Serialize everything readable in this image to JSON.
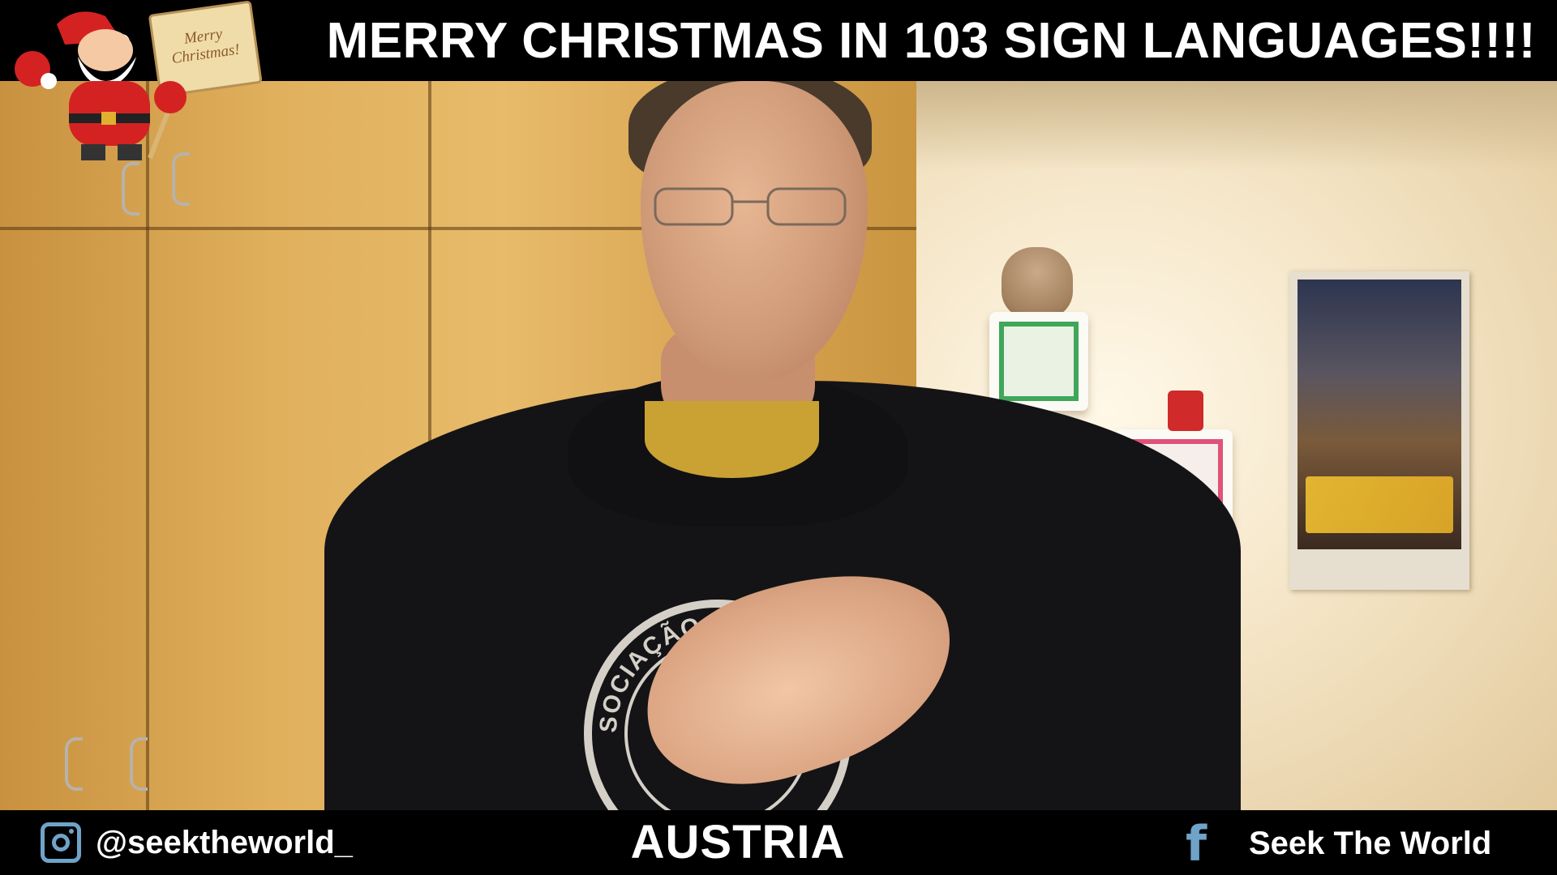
{
  "header": {
    "title": "MERRY CHRISTMAS IN 103 SIGN LANGUAGES!!!!"
  },
  "sticker": {
    "sign_line1": "Merry",
    "sign_line2": "Christmas!"
  },
  "hoodie": {
    "print_text": "SOCIAÇÃO CHAPECOENSE"
  },
  "footer": {
    "instagram_handle": "@seektheworld_",
    "country": "AUSTRIA",
    "facebook_page": "Seek The World"
  },
  "icons": {
    "instagram": "instagram-icon",
    "facebook": "facebook-icon",
    "santa": "santa-claus-icon"
  },
  "colors": {
    "bar_background": "#000000",
    "text": "#ffffff",
    "icon_accent": "#6fa3c8"
  }
}
